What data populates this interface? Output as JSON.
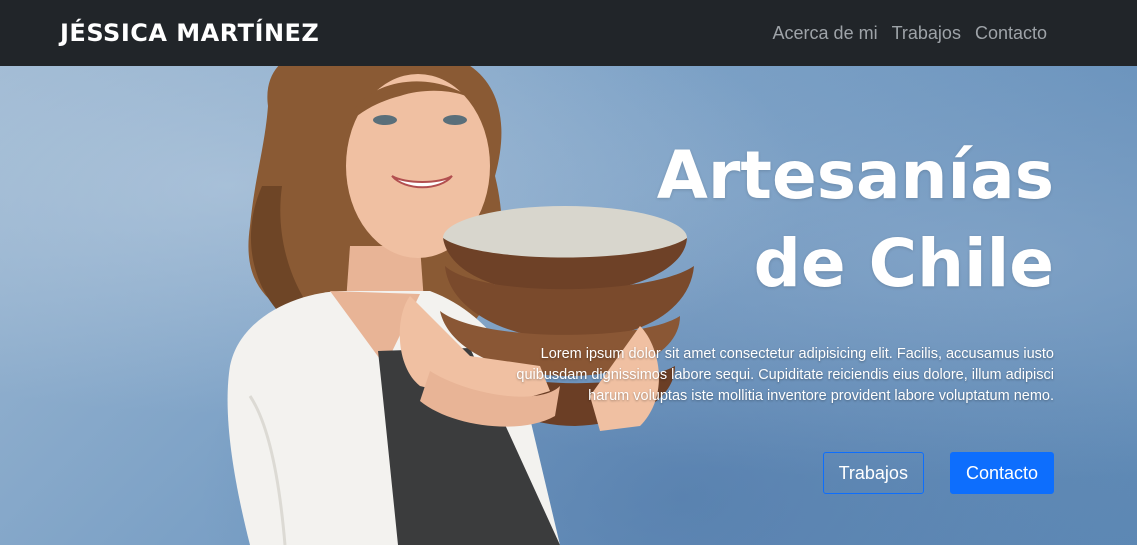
{
  "navbar": {
    "brand": "JÉSSICA MARTÍNEZ",
    "links": [
      {
        "label": "Acerca de mi"
      },
      {
        "label": "Trabajos"
      },
      {
        "label": "Contacto"
      }
    ]
  },
  "hero": {
    "title_line1": "Artesanías",
    "title_line2": "de Chile",
    "text": "Lorem ipsum dolor sit amet consectetur adipisicing elit. Facilis, accusamus iusto quibusdam dignissimos labore sequi. Cupiditate reiciendis eius dolore, illum adipisci harum voluptas iste mollitia inventore provident labore voluptatum nemo.",
    "buttons": {
      "secondary": "Trabajos",
      "primary": "Contacto"
    }
  },
  "colors": {
    "navbar_bg": "#212529",
    "nav_link": "#9ea3a8",
    "accent": "#0d6efd",
    "hero_bg": "#7ca1c6"
  }
}
